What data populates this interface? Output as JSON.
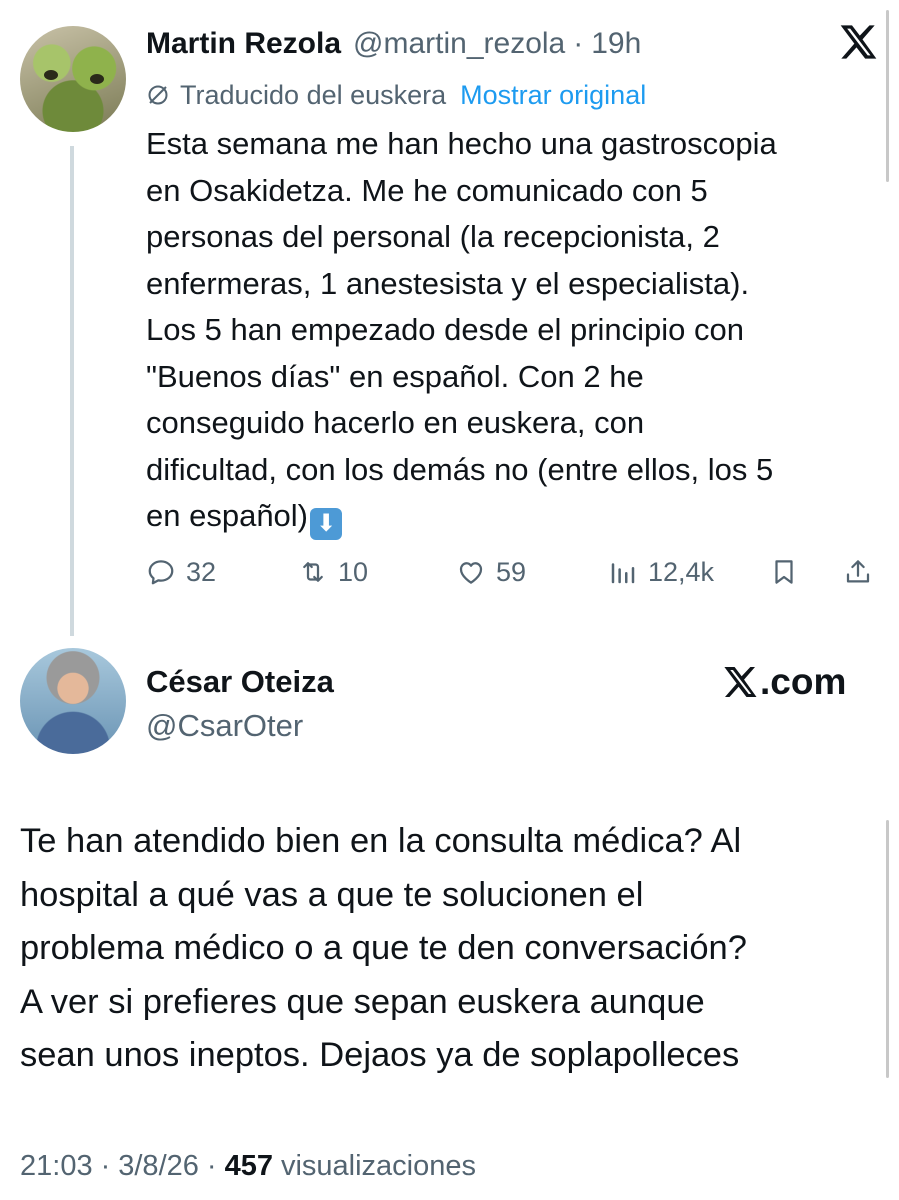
{
  "tweet1": {
    "author_name": "Martin Rezola",
    "handle": "@martin_rezola",
    "separator": "·",
    "time": "19h",
    "translated_label": "Traducido del euskera",
    "show_original": "Mostrar original",
    "body": "Esta semana me han hecho una gastroscopia\nen Osakidetza. Me he comunicado con 5\npersonas del personal (la recepcionista, 2\nenfermeras, 1 anestesista y el especialista).\nLos 5 han empezado desde el principio con\n\"Buenos días\" en español. Con 2 he\nconseguido hacerlo en euskera, con\ndificultad, con los demás no (entre ellos, los 5\nen español)",
    "emoji": "⬇",
    "replies": "32",
    "retweets": "10",
    "likes": "59",
    "views": "12,4k"
  },
  "tweet2": {
    "author_name": "César Oteiza",
    "handle": "@CsarOter",
    "site_label": ".com",
    "body": "Te han atendido bien en la consulta médica? Al\nhospital a qué vas a que te solucionen el\nproblema médico o a que te den conversación?\nA ver si prefieres que sepan euskera aunque\nsean unos ineptos. Dejaos ya de soplapolleces",
    "time": "21:03",
    "date": "3/8/26",
    "separator": "·",
    "views_count": "457",
    "views_label": "visualizaciones"
  },
  "icons": {
    "x_logo": "x-logo-icon",
    "translate": "translate-icon",
    "reply": "reply-icon",
    "retweet": "retweet-icon",
    "like": "heart-icon",
    "views": "views-icon",
    "bookmark": "bookmark-icon",
    "share": "share-icon"
  },
  "colors": {
    "text": "#0f1419",
    "secondary": "#536471",
    "link": "#1d9bf0",
    "thread_line": "#cfd9de"
  }
}
